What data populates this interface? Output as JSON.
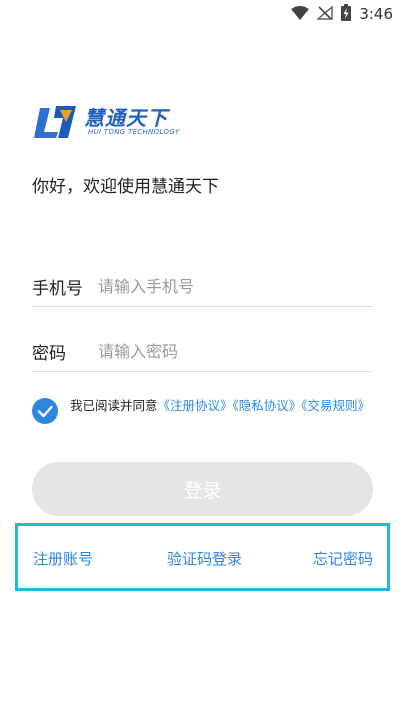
{
  "status_bar": {
    "time": "3:46",
    "icons": [
      "wifi-icon",
      "no-signal-icon",
      "battery-charging-icon"
    ]
  },
  "logo": {
    "brand": "慧通天下",
    "subtitle": "HUI TONG TECHNOLOGY"
  },
  "welcome_text": "你好，欢迎使用慧通天下",
  "phone_field": {
    "label": "手机号",
    "placeholder": "请输入手机号",
    "value": ""
  },
  "password_field": {
    "label": "密码",
    "placeholder": "请输入密码",
    "value": ""
  },
  "agreement": {
    "checked": true,
    "prefix": "我已阅读并同意",
    "register_agreement": "《注册协议》",
    "privacy_agreement": "《隐私协议》",
    "trade_rules": "《交易规则》"
  },
  "login_button": "登录",
  "links": {
    "register": "注册账号",
    "code_login": "验证码登录",
    "forgot_password": "忘记密码"
  },
  "colors": {
    "accent": "#2d86e0",
    "highlight_border": "#1fb5e8",
    "button_disabled": "#e4e4e4",
    "logo_blue": "#1f5fbf"
  }
}
